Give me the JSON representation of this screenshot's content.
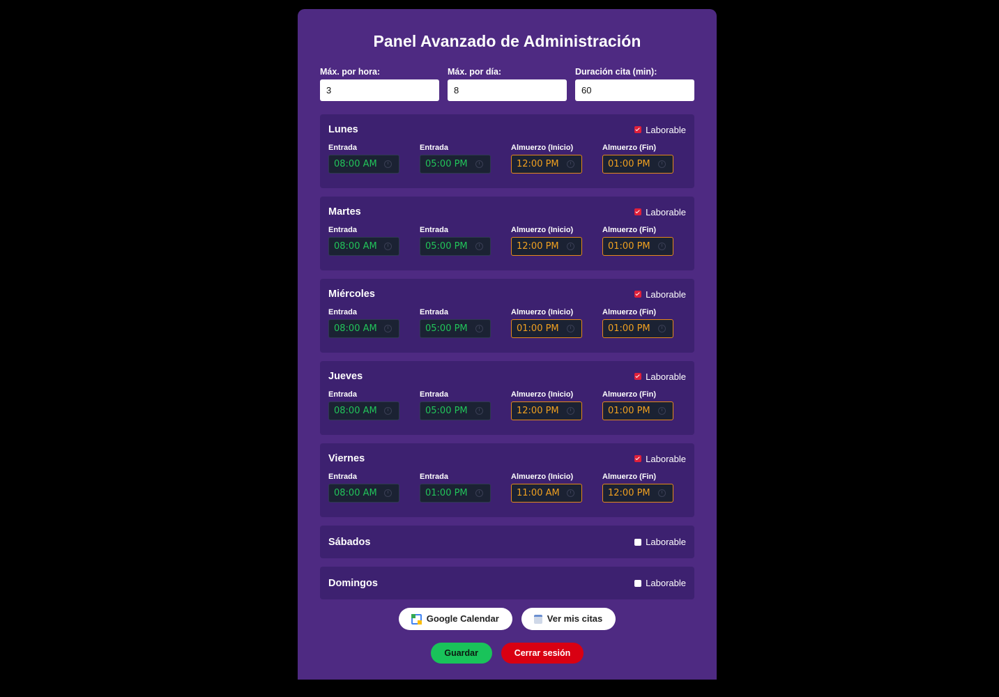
{
  "title": "Panel Avanzado de Administración",
  "limits": [
    {
      "label": "Máx. por hora:",
      "value": "3"
    },
    {
      "label": "Máx. por día:",
      "value": "8"
    },
    {
      "label": "Duración cita (min):",
      "value": "60"
    }
  ],
  "labels": {
    "laborable": "Laborable",
    "entrada": "Entrada",
    "almuerzo_inicio": "Almuerzo (Inicio)",
    "almuerzo_fin": "Almuerzo (Fin)"
  },
  "days": [
    {
      "name": "Lunes",
      "laborable": true,
      "entrada1": "08:00 AM",
      "entrada2": "05:00 PM",
      "lunch_start": "12:00 PM",
      "lunch_end": "01:00 PM"
    },
    {
      "name": "Martes",
      "laborable": true,
      "entrada1": "08:00 AM",
      "entrada2": "05:00 PM",
      "lunch_start": "12:00 PM",
      "lunch_end": "01:00 PM"
    },
    {
      "name": "Miércoles",
      "laborable": true,
      "entrada1": "08:00 AM",
      "entrada2": "05:00 PM",
      "lunch_start": "01:00 PM",
      "lunch_end": "01:00 PM"
    },
    {
      "name": "Jueves",
      "laborable": true,
      "entrada1": "08:00 AM",
      "entrada2": "05:00 PM",
      "lunch_start": "12:00 PM",
      "lunch_end": "01:00 PM"
    },
    {
      "name": "Viernes",
      "laborable": true,
      "entrada1": "08:00 AM",
      "entrada2": "01:00 PM",
      "lunch_start": "11:00 AM",
      "lunch_end": "12:00 PM"
    },
    {
      "name": "Sábados",
      "laborable": false
    },
    {
      "name": "Domingos",
      "laborable": false
    }
  ],
  "links": {
    "google_calendar": "Google Calendar",
    "ver_citas": "Ver mis citas"
  },
  "actions": {
    "save": "Guardar",
    "logout": "Cerrar sesión"
  },
  "colors": {
    "panel": "#4e2a82",
    "day_card": "#3d2170",
    "time_green": "#22c45a",
    "time_orange": "#f0a020",
    "save": "#19c35a",
    "logout": "#d90012",
    "checkbox_on": "#e0203a"
  }
}
